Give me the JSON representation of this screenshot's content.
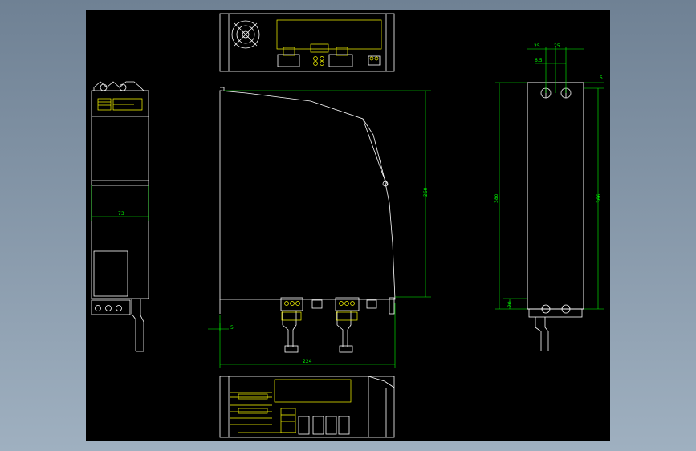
{
  "colors": {
    "outline": "#ffffff",
    "dimension": "#00ff00",
    "detail": "#ffff00",
    "background": "#000000",
    "frame": "#8a9aab"
  },
  "dimensions": {
    "side_width": "73",
    "top_pitch_left": "25",
    "top_pitch_right": "25",
    "hole_offset": "6.5",
    "corner_offset": "5",
    "overall_height": "380",
    "hole_span": "366",
    "bottom_offset": "20",
    "front_height": "260",
    "depth": "224",
    "foot_offset": "5"
  }
}
